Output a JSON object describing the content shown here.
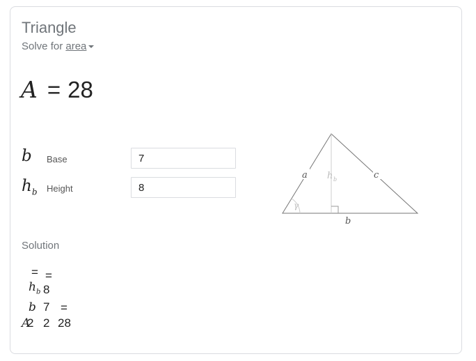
{
  "calculator": {
    "title": "Triangle",
    "solve_for_prefix": "Solve for ",
    "solve_for_value": "area",
    "result_var": "A",
    "result_eq": "=",
    "result_value": "28"
  },
  "inputs": [
    {
      "symbol": "b",
      "subscript": "",
      "label": "Base",
      "value": "7"
    },
    {
      "symbol": "h",
      "subscript": "b",
      "label": "Height",
      "value": "8"
    }
  ],
  "diagram": {
    "labels": {
      "a": "a",
      "c": "c",
      "b": "b",
      "h": "h",
      "h_sub": "b",
      "gamma": "γ"
    }
  },
  "solution": {
    "title": "Solution",
    "tokens": {
      "eq1": "=",
      "eq2": "=",
      "eq3": "=",
      "hb_var": "h",
      "hb_sub": "b",
      "hb_val": "8",
      "b_var": "b",
      "b_val": "7",
      "A_var": "A",
      "two1": "2",
      "two2": "2",
      "result": "28"
    }
  },
  "colors": {
    "label_gray": "#70757a",
    "border": "#dadce0",
    "diagram_line": "#757575",
    "diagram_faint": "#cccccc"
  }
}
